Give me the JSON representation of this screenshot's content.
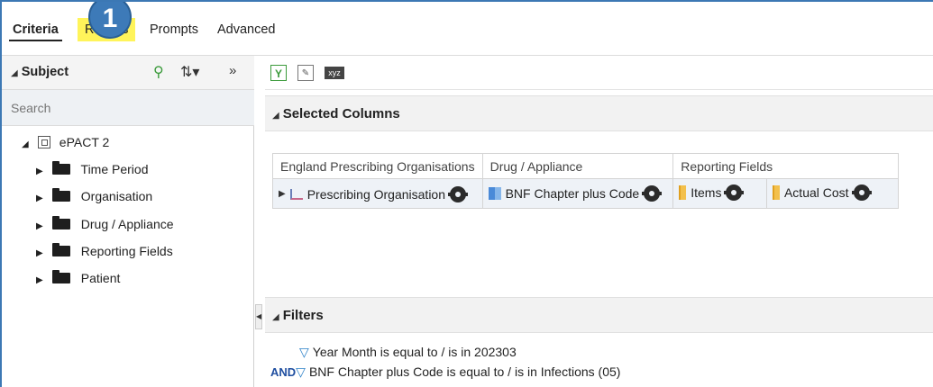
{
  "tabs": [
    {
      "label": "Criteria"
    },
    {
      "label": "Results"
    },
    {
      "label": "Prompts"
    },
    {
      "label": "Advanced"
    }
  ],
  "step_badge": "1",
  "subject": {
    "title": "Subject",
    "search_placeholder": "Search",
    "tree": {
      "root": "ePACT 2",
      "children": [
        "Time Period",
        "Organisation",
        "Drug / Appliance",
        "Reporting Fields",
        "Patient"
      ]
    }
  },
  "toolbar": {
    "xyz_label": "xyz"
  },
  "selected_columns": {
    "title": "Selected Columns",
    "groups": [
      "England Prescribing Organisations",
      "Drug / Appliance",
      "Reporting Fields"
    ],
    "columns": [
      "Prescribing Organisation",
      "BNF Chapter plus Code",
      "Items",
      "Actual Cost"
    ]
  },
  "filters": {
    "title": "Filters",
    "lines": [
      {
        "prefix": "",
        "text": "Year Month is equal to / is in  202303"
      },
      {
        "prefix": "AND",
        "text": "BNF Chapter plus Code is equal to / is in  Infections (05)"
      }
    ]
  },
  "colors": {
    "accent": "#3d7ab8",
    "highlight": "#fff45a",
    "and_blue": "#1f4ea0"
  }
}
